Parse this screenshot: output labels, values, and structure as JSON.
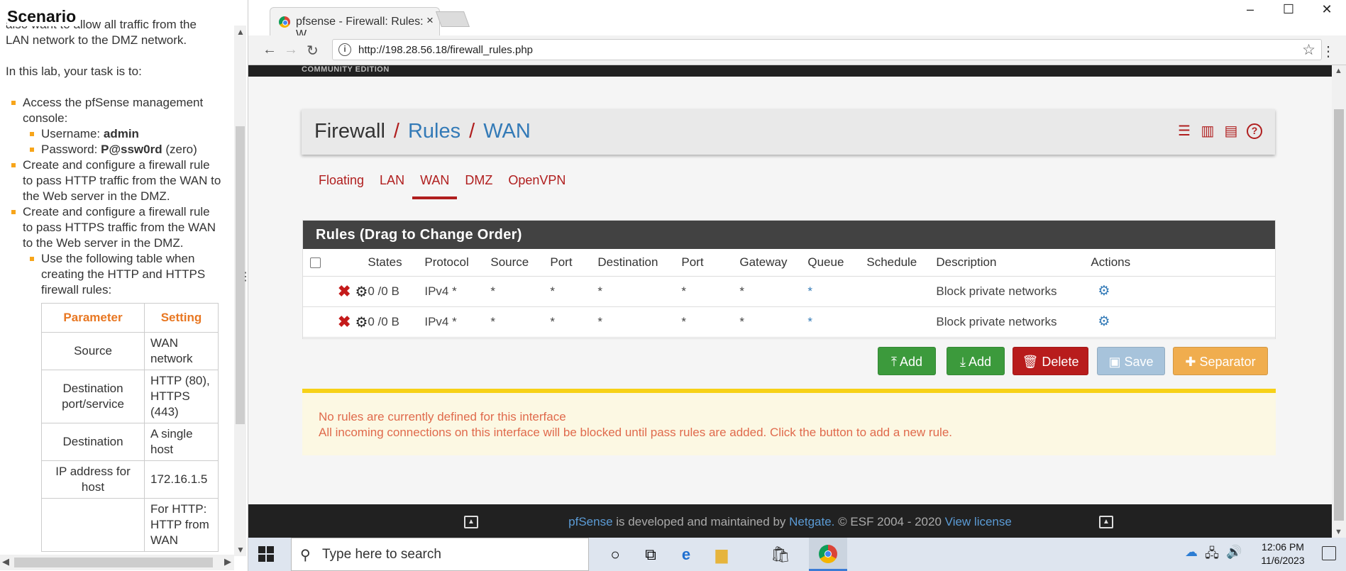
{
  "scenario": {
    "title": "Scenario",
    "para1": "also want to allow all traffic from the LAN network to the DMZ network.",
    "para2": "In this lab, your task is to:",
    "bullets": {
      "b1": "Access the pfSense management console:",
      "b1_user_label": "Username:",
      "b1_user_value": "admin",
      "b1_pass_label": "Password:",
      "b1_pass_value": "P@ssw0rd",
      "b1_pass_note": "(zero)",
      "b2": "Create and configure a firewall rule to pass HTTP traffic from the WAN to the Web server in the DMZ.",
      "b3": "Create and configure a firewall rule to pass HTTPS traffic from the WAN to the Web server in the DMZ.",
      "b3_sub": "Use the following table when creating the HTTP and HTTPS firewall rules:"
    },
    "table": {
      "headers": [
        "Parameter",
        "Setting"
      ],
      "rows": [
        [
          "Source",
          "WAN network"
        ],
        [
          "Destination port/service",
          "HTTP (80), HTTPS (443)"
        ],
        [
          "Destination",
          "A single host"
        ],
        [
          "IP address for host",
          "172.16.1.5"
        ],
        [
          "",
          "For HTTP: HTTP from WAN"
        ]
      ]
    }
  },
  "browser": {
    "tab_title": "pfsense - Firewall: Rules: W...",
    "url": "http://198.28.56.18/firewall_rules.php"
  },
  "pfsense": {
    "edition": "COMMUNITY EDITION",
    "breadcrumb": {
      "part1": "Firewall",
      "part2": "Rules",
      "part3": "WAN"
    },
    "tabs": [
      "Floating",
      "LAN",
      "WAN",
      "DMZ",
      "OpenVPN"
    ],
    "active_tab": "WAN",
    "rules_heading": "Rules (Drag to Change Order)",
    "columns": [
      "States",
      "Protocol",
      "Source",
      "Port",
      "Destination",
      "Port",
      "Gateway",
      "Queue",
      "Schedule",
      "Description",
      "Actions"
    ],
    "rules": [
      {
        "states": "0 /0 B",
        "protocol": "IPv4 *",
        "source": "*",
        "port": "*",
        "destination": "*",
        "dport": "*",
        "gateway": "*",
        "queue": "*",
        "schedule": "",
        "description": "Block private networks"
      },
      {
        "states": "0 /0 B",
        "protocol": "IPv4 *",
        "source": "*",
        "port": "*",
        "destination": "*",
        "dport": "*",
        "gateway": "*",
        "queue": "*",
        "schedule": "",
        "description": "Block private networks"
      }
    ],
    "buttons": {
      "add_top": "Add",
      "add_bottom": "Add",
      "delete": "Delete",
      "save": "Save",
      "separator": "Separator"
    },
    "alert": {
      "line1": "No rules are currently defined for this interface",
      "line2": "All incoming connections on this interface will be blocked until pass rules are added. Click the button to add a new rule."
    },
    "footer": {
      "brand": "pfSense",
      "mid": "is developed and maintained by",
      "netgate": "Netgate.",
      "copy": "© ESF 2004 - 2020",
      "license": "View license"
    },
    "colors": {
      "accent": "#b01e1e",
      "link": "#337ab7",
      "success": "#3c9a3c",
      "danger": "#b81c1c",
      "warning": "#f0ad4e"
    }
  },
  "taskbar": {
    "search_placeholder": "Type here to search",
    "time": "12:06 PM",
    "date": "11/6/2023"
  }
}
